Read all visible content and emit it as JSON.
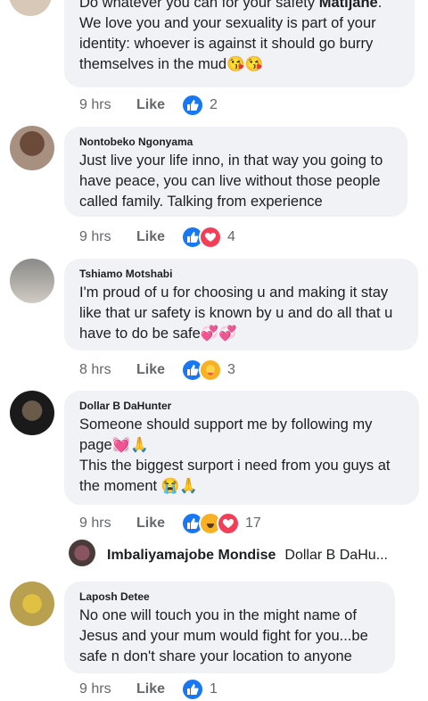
{
  "comments": [
    {
      "text_line0": "Do whatever you can for your safety ",
      "bold_name": "Matijane",
      "text": ". We love you and your sexuality is part of your identity: whoever is against it should go burry themselves in the mud",
      "emoji": "😘😘",
      "time": "9 hrs",
      "like": "Like",
      "count": "2"
    },
    {
      "author": "Nontobeko Ngonyama",
      "text": "Just live your life inno, in that way you going to have peace, you can live without those people called family. Talking from experience",
      "time": "9 hrs",
      "like": "Like",
      "count": "4"
    },
    {
      "author": "Tshiamo Motshabi",
      "text": "I'm proud of u for choosing u and making it stay like that ur safety is known by u and do all that u have to do be safe",
      "emoji": "💞💞",
      "time": "8 hrs",
      "like": "Like",
      "count": "3"
    },
    {
      "author": "Dollar B DaHunter",
      "line1": "Someone should support me by following my page",
      "line1_emoji": "💓🙏",
      "line2": "This the biggest surport i need from you guys at the moment",
      "line2_emoji": "😭🙏",
      "time": "9 hrs",
      "like": "Like",
      "count": "17"
    },
    {
      "author": "Laposh Detee",
      "text": "No one will touch you in the might name of Jesus and your mum would fight for you...be safe n don't share your location to anyone",
      "time": "9 hrs",
      "like": "Like",
      "count": "1"
    }
  ],
  "reply": {
    "name": "Imbaliyamajobe Mondise",
    "text": "Dollar B DaHu..."
  },
  "colors": {
    "like_blue": "#1877f2",
    "heart_red": "#f33e58",
    "haha_yellow": "#f7b125",
    "bubble": "#f0f2f5"
  },
  "icons": [
    "like-reaction-icon",
    "love-reaction-icon",
    "care-reaction-icon",
    "haha-reaction-icon"
  ]
}
